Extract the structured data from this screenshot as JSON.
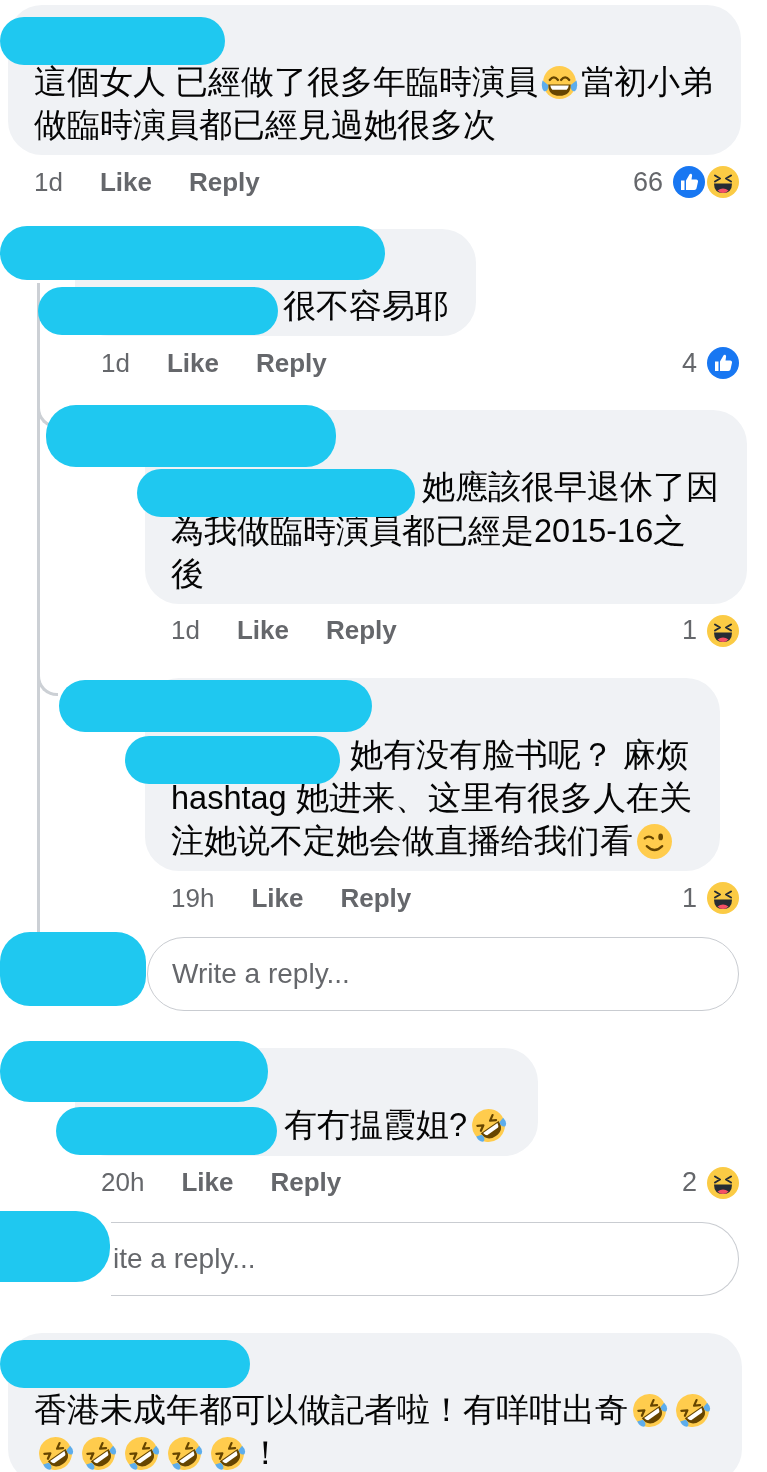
{
  "comments": [
    {
      "author_redacted": true,
      "lines": [
        [
          {
            "kind": "text",
            "text": "這個女人 已經做了很多年臨時演員"
          },
          {
            "kind": "joy"
          },
          {
            "kind": "text",
            "text": "當初小弟"
          }
        ],
        [
          {
            "kind": "text",
            "text": "做臨時演員都已經見過她很多次"
          }
        ]
      ],
      "time": "1d",
      "like_label": "Like",
      "reply_label": "Reply",
      "reaction_count": "66",
      "reactions": [
        {
          "kind": "like"
        },
        {
          "kind": "haha"
        }
      ],
      "replies": [
        {
          "author_redacted": true,
          "lines": [
            [
              {
                "kind": "redacted"
              },
              {
                "kind": "text",
                "text": "很不容易耶"
              }
            ]
          ],
          "time": "1d",
          "like_label": "Like",
          "reply_label": "Reply",
          "reaction_count": "4",
          "reactions": [
            {
              "kind": "like"
            }
          ],
          "replies": [
            {
              "author_redacted": true,
              "lines": [
                [
                  {
                    "kind": "redacted"
                  },
                  {
                    "kind": "text",
                    "text": "她應該很早退休了因"
                  }
                ],
                [
                  {
                    "kind": "text",
                    "text": "為我做臨時演員都已經是2015-16之"
                  }
                ],
                [
                  {
                    "kind": "text",
                    "text": "後"
                  }
                ]
              ],
              "time": "1d",
              "like_label": "Like",
              "reply_label": "Reply",
              "reaction_count": "1",
              "reactions": [
                {
                  "kind": "haha"
                }
              ]
            },
            {
              "author_redacted": true,
              "lines": [
                [
                  {
                    "kind": "redacted"
                  },
                  {
                    "kind": "text",
                    "text": "她有没有脸书呢？ 麻烦"
                  }
                ],
                [
                  {
                    "kind": "text",
                    "text": "hashtag 她进来、这里有很多人在关"
                  }
                ],
                [
                  {
                    "kind": "text",
                    "text": "注她说不定她会做直播给我们看"
                  },
                  {
                    "kind": "wink"
                  }
                ]
              ],
              "time": "19h",
              "like_label": "Like",
              "reply_label": "Reply",
              "reaction_count": "1",
              "reactions": [
                {
                  "kind": "haha"
                }
              ]
            }
          ],
          "reply_field": {
            "avatar_redacted": true,
            "placeholder": "Write a reply..."
          }
        },
        {
          "author_redacted": true,
          "lines": [
            [
              {
                "kind": "redacted"
              },
              {
                "kind": "text",
                "text": "有冇揾霞姐?"
              },
              {
                "kind": "rofl"
              }
            ]
          ],
          "time": "20h",
          "like_label": "Like",
          "reply_label": "Reply",
          "reaction_count": "2",
          "reactions": [
            {
              "kind": "haha"
            }
          ]
        }
      ],
      "reply_field": {
        "avatar_redacted": true,
        "placeholder": "ite a reply..."
      }
    },
    {
      "author_redacted": true,
      "lines": [
        [
          {
            "kind": "text",
            "text": "香港未成年都可以做記者啦！有咩咁出奇"
          },
          {
            "kind": "rofl"
          },
          {
            "kind": "rofl"
          }
        ],
        [
          {
            "kind": "rofl"
          },
          {
            "kind": "rofl"
          },
          {
            "kind": "rofl"
          },
          {
            "kind": "rofl"
          },
          {
            "kind": "rofl"
          },
          {
            "kind": "text",
            "text": "！"
          }
        ]
      ]
    }
  ]
}
